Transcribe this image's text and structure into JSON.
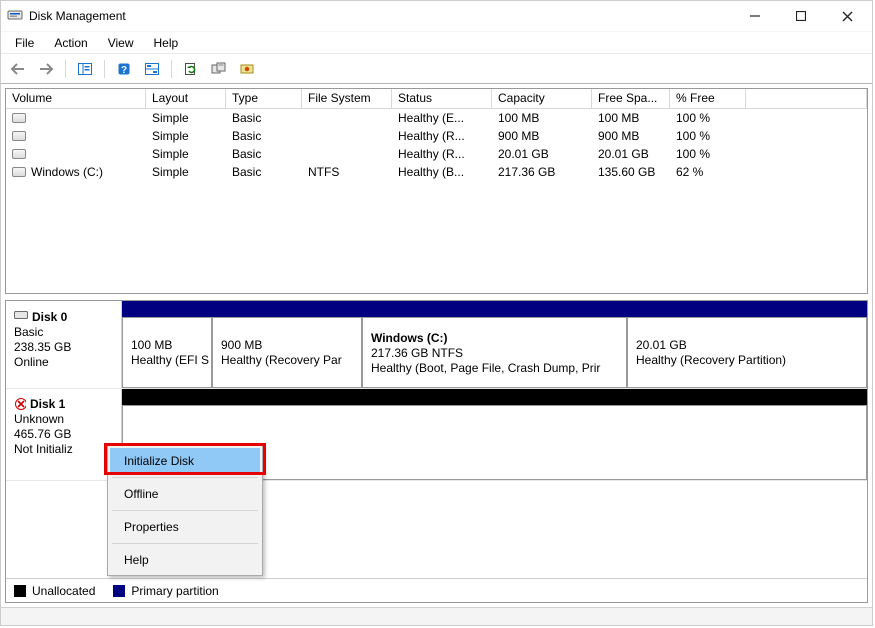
{
  "window": {
    "title": "Disk Management"
  },
  "menubar": [
    "File",
    "Action",
    "View",
    "Help"
  ],
  "columns": {
    "volume": "Volume",
    "layout": "Layout",
    "type": "Type",
    "fs": "File System",
    "status": "Status",
    "capacity": "Capacity",
    "free": "Free Spa...",
    "pct": "% Free"
  },
  "volumes": [
    {
      "name": "",
      "layout": "Simple",
      "type": "Basic",
      "fs": "",
      "status": "Healthy (E...",
      "capacity": "100 MB",
      "free": "100 MB",
      "pct": "100 %"
    },
    {
      "name": "",
      "layout": "Simple",
      "type": "Basic",
      "fs": "",
      "status": "Healthy (R...",
      "capacity": "900 MB",
      "free": "900 MB",
      "pct": "100 %"
    },
    {
      "name": "",
      "layout": "Simple",
      "type": "Basic",
      "fs": "",
      "status": "Healthy (R...",
      "capacity": "20.01 GB",
      "free": "20.01 GB",
      "pct": "100 %"
    },
    {
      "name": "Windows (C:)",
      "layout": "Simple",
      "type": "Basic",
      "fs": "NTFS",
      "status": "Healthy (B...",
      "capacity": "217.36 GB",
      "free": "135.60 GB",
      "pct": "62 %"
    }
  ],
  "disks": {
    "d0": {
      "name": "Disk 0",
      "type": "Basic",
      "size": "238.35 GB",
      "state": "Online",
      "parts": {
        "p0": {
          "title": "",
          "line1": "100 MB",
          "line2": "Healthy (EFI S"
        },
        "p1": {
          "title": "",
          "line1": "900 MB",
          "line2": "Healthy (Recovery Par"
        },
        "p2": {
          "title": "Windows  (C:)",
          "line1": "217.36 GB NTFS",
          "line2": "Healthy (Boot, Page File, Crash Dump, Prir"
        },
        "p3": {
          "title": "",
          "line1": "20.01 GB",
          "line2": "Healthy (Recovery Partition)"
        }
      }
    },
    "d1": {
      "name": "Disk 1",
      "type": "Unknown",
      "size": "465.76 GB",
      "state": "Not Initializ"
    }
  },
  "legend": {
    "unallocated": "Unallocated",
    "primary": "Primary partition"
  },
  "context_menu": {
    "initialize": "Initialize Disk",
    "offline": "Offline",
    "properties": "Properties",
    "help": "Help"
  }
}
